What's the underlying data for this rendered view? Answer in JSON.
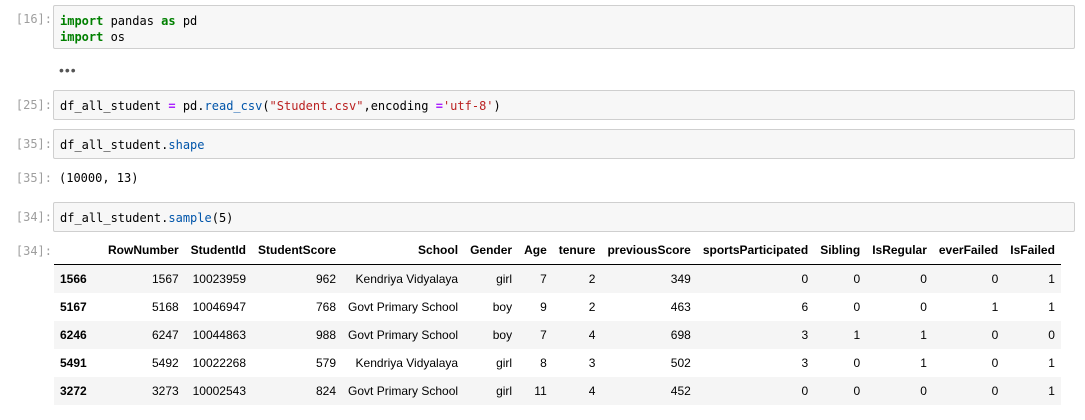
{
  "cells": {
    "c16": {
      "prompt": "[16]:",
      "line1_kw": "import",
      "line1_rest": " pandas ",
      "line1_kw2": "as",
      "line1_rest2": " pd",
      "line2_kw": "import",
      "line2_rest": " os"
    },
    "ellipsis": "•••",
    "c25": {
      "prompt": "[25]:",
      "pre": "df_all_student ",
      "eq": "=",
      "mid": " pd.",
      "fn": "read_csv",
      "open": "(",
      "str1": "\"Student.csv\"",
      "comma": ",encoding ",
      "eq2": "=",
      "str2": "'utf-8'",
      "close": ")"
    },
    "c35": {
      "prompt": "[35]:",
      "pre": "df_all_student.",
      "attr": "shape",
      "out_prompt": "[35]:",
      "output": "(10000, 13)"
    },
    "c34": {
      "prompt": "[34]:",
      "pre": "df_all_student.",
      "fn": "sample",
      "args": "(5)",
      "out_prompt": "[34]:"
    }
  },
  "table": {
    "columns": [
      "RowNumber",
      "StudentId",
      "StudentScore",
      "School",
      "Gender",
      "Age",
      "tenure",
      "previousScore",
      "sportsParticipated",
      "Sibling",
      "IsRegular",
      "everFailed",
      "IsFailed"
    ],
    "rows": [
      {
        "index": "1566",
        "values": [
          "1567",
          "10023959",
          "962",
          "Kendriya Vidyalaya",
          "girl",
          "7",
          "2",
          "349",
          "0",
          "0",
          "0",
          "0",
          "1"
        ]
      },
      {
        "index": "5167",
        "values": [
          "5168",
          "10046947",
          "768",
          "Govt Primary School",
          "boy",
          "9",
          "2",
          "463",
          "6",
          "0",
          "0",
          "1",
          "1"
        ]
      },
      {
        "index": "6246",
        "values": [
          "6247",
          "10044863",
          "988",
          "Govt Primary School",
          "boy",
          "7",
          "4",
          "698",
          "3",
          "1",
          "1",
          "0",
          "0"
        ]
      },
      {
        "index": "5491",
        "values": [
          "5492",
          "10022268",
          "579",
          "Kendriya Vidyalaya",
          "girl",
          "8",
          "3",
          "502",
          "3",
          "0",
          "1",
          "0",
          "1"
        ]
      },
      {
        "index": "3272",
        "values": [
          "3273",
          "10002543",
          "824",
          "Govt Primary School",
          "girl",
          "11",
          "4",
          "452",
          "0",
          "0",
          "0",
          "0",
          "1"
        ]
      }
    ]
  }
}
